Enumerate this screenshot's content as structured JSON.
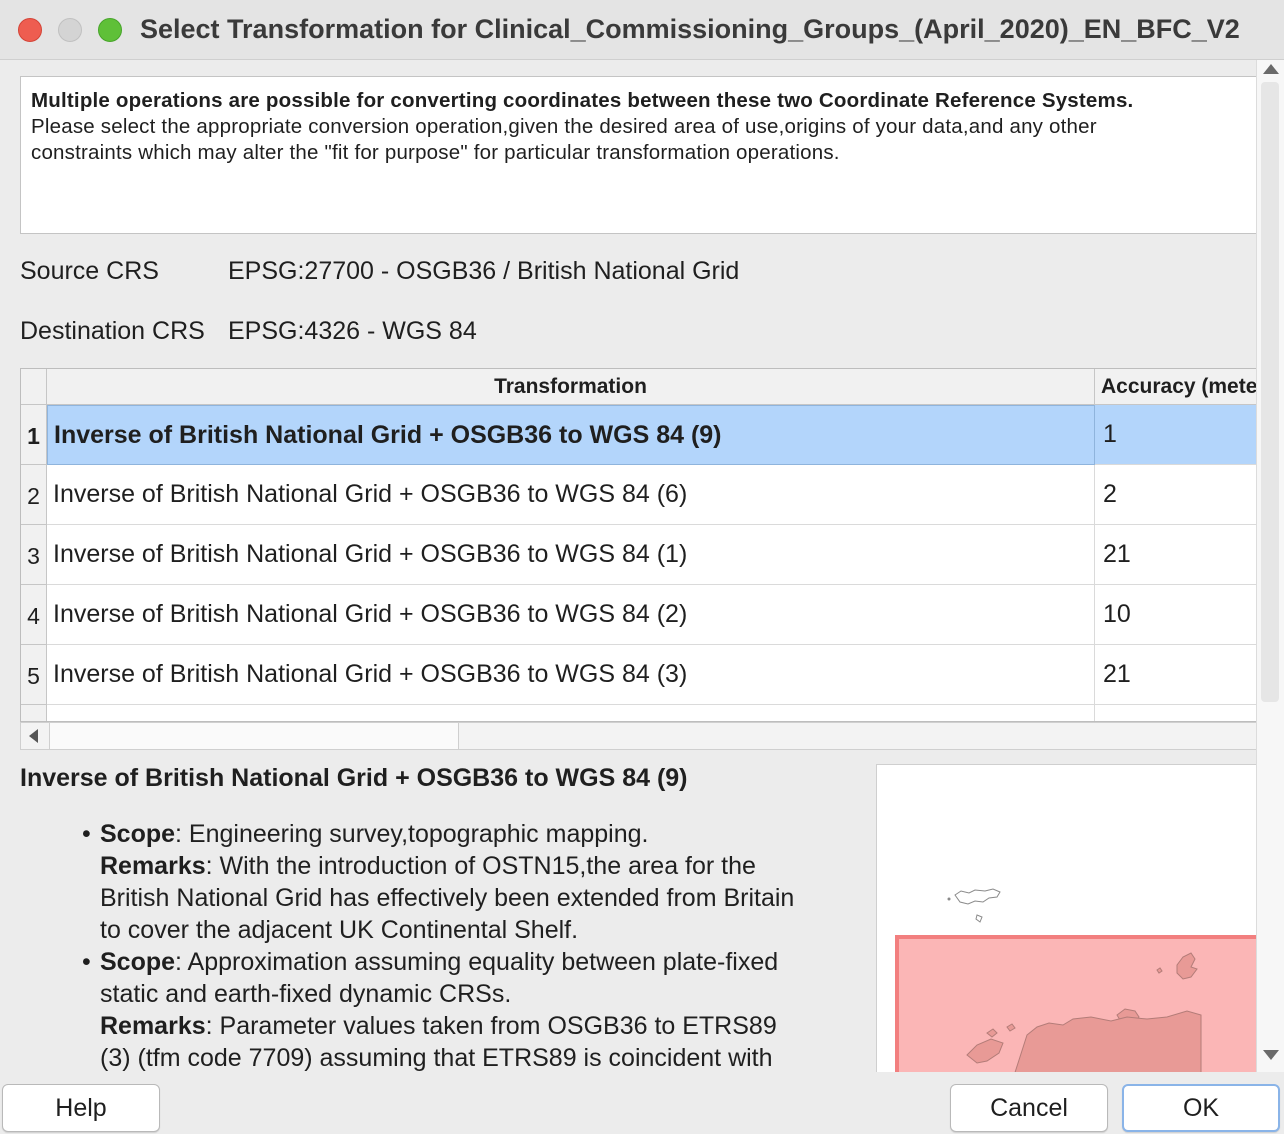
{
  "window": {
    "title": "Select Transformation for Clinical_Commissioning_Groups_(April_2020)_EN_BFC_V2"
  },
  "info": {
    "heading": "Multiple operations are possible for converting coordinates between these two Coordinate Reference Systems.",
    "line1": "Please select the appropriate conversion operation,given the desired area of use,origins of your data,and any other",
    "line2": "constraints which may alter the \"fit for purpose\" for particular transformation operations."
  },
  "source_crs": {
    "label": "Source CRS",
    "value": "EPSG:27700 - OSGB36 / British National Grid"
  },
  "destination_crs": {
    "label": "Destination CRS",
    "value": "EPSG:4326 - WGS 84"
  },
  "table": {
    "headers": {
      "transformation": "Transformation",
      "accuracy": "Accuracy (meters)"
    },
    "rows": [
      {
        "num": "1",
        "name": "Inverse of British National Grid + OSGB36 to WGS 84 (9)",
        "accuracy": "1",
        "selected": true
      },
      {
        "num": "2",
        "name": "Inverse of British National Grid + OSGB36 to WGS 84 (6)",
        "accuracy": "2"
      },
      {
        "num": "3",
        "name": "Inverse of British National Grid + OSGB36 to WGS 84 (1)",
        "accuracy": "21"
      },
      {
        "num": "4",
        "name": "Inverse of British National Grid + OSGB36 to WGS 84 (2)",
        "accuracy": "10"
      },
      {
        "num": "5",
        "name": "Inverse of British National Grid + OSGB36 to WGS 84 (3)",
        "accuracy": "21"
      }
    ]
  },
  "details": {
    "title": "Inverse of British National Grid + OSGB36 to WGS 84 (9)",
    "scope_label": "Scope",
    "remarks_label": "Remarks",
    "items": [
      {
        "scope": ": Engineering survey,topographic mapping.",
        "remarks_lines": [
          ": With the introduction of OSTN15,the area for the",
          "British National Grid has effectively been extended from Britain",
          "to cover the adjacent UK Continental Shelf."
        ]
      },
      {
        "scope_lines": [
          ": Approximation assuming equality between plate-fixed",
          "static and earth-fixed dynamic CRSs."
        ],
        "remarks_lines": [
          ": Parameter values taken from OSGB36 to ETRS89",
          "(3) (tfm code 7709) assuming that ETRS89 is coincident with"
        ]
      }
    ]
  },
  "map": {
    "area_fill": "#fbb6b6",
    "area_stroke": "#f27f7f",
    "land_fill": "#e89a96",
    "land_stroke": "#b37c78"
  },
  "buttons": {
    "help": "Help",
    "cancel": "Cancel",
    "ok": "OK"
  },
  "colors": {
    "selection": "#b3d5fb",
    "ok_focus": "#8ab4e8",
    "close": "#ee5d50",
    "maximize": "#5fc038"
  }
}
